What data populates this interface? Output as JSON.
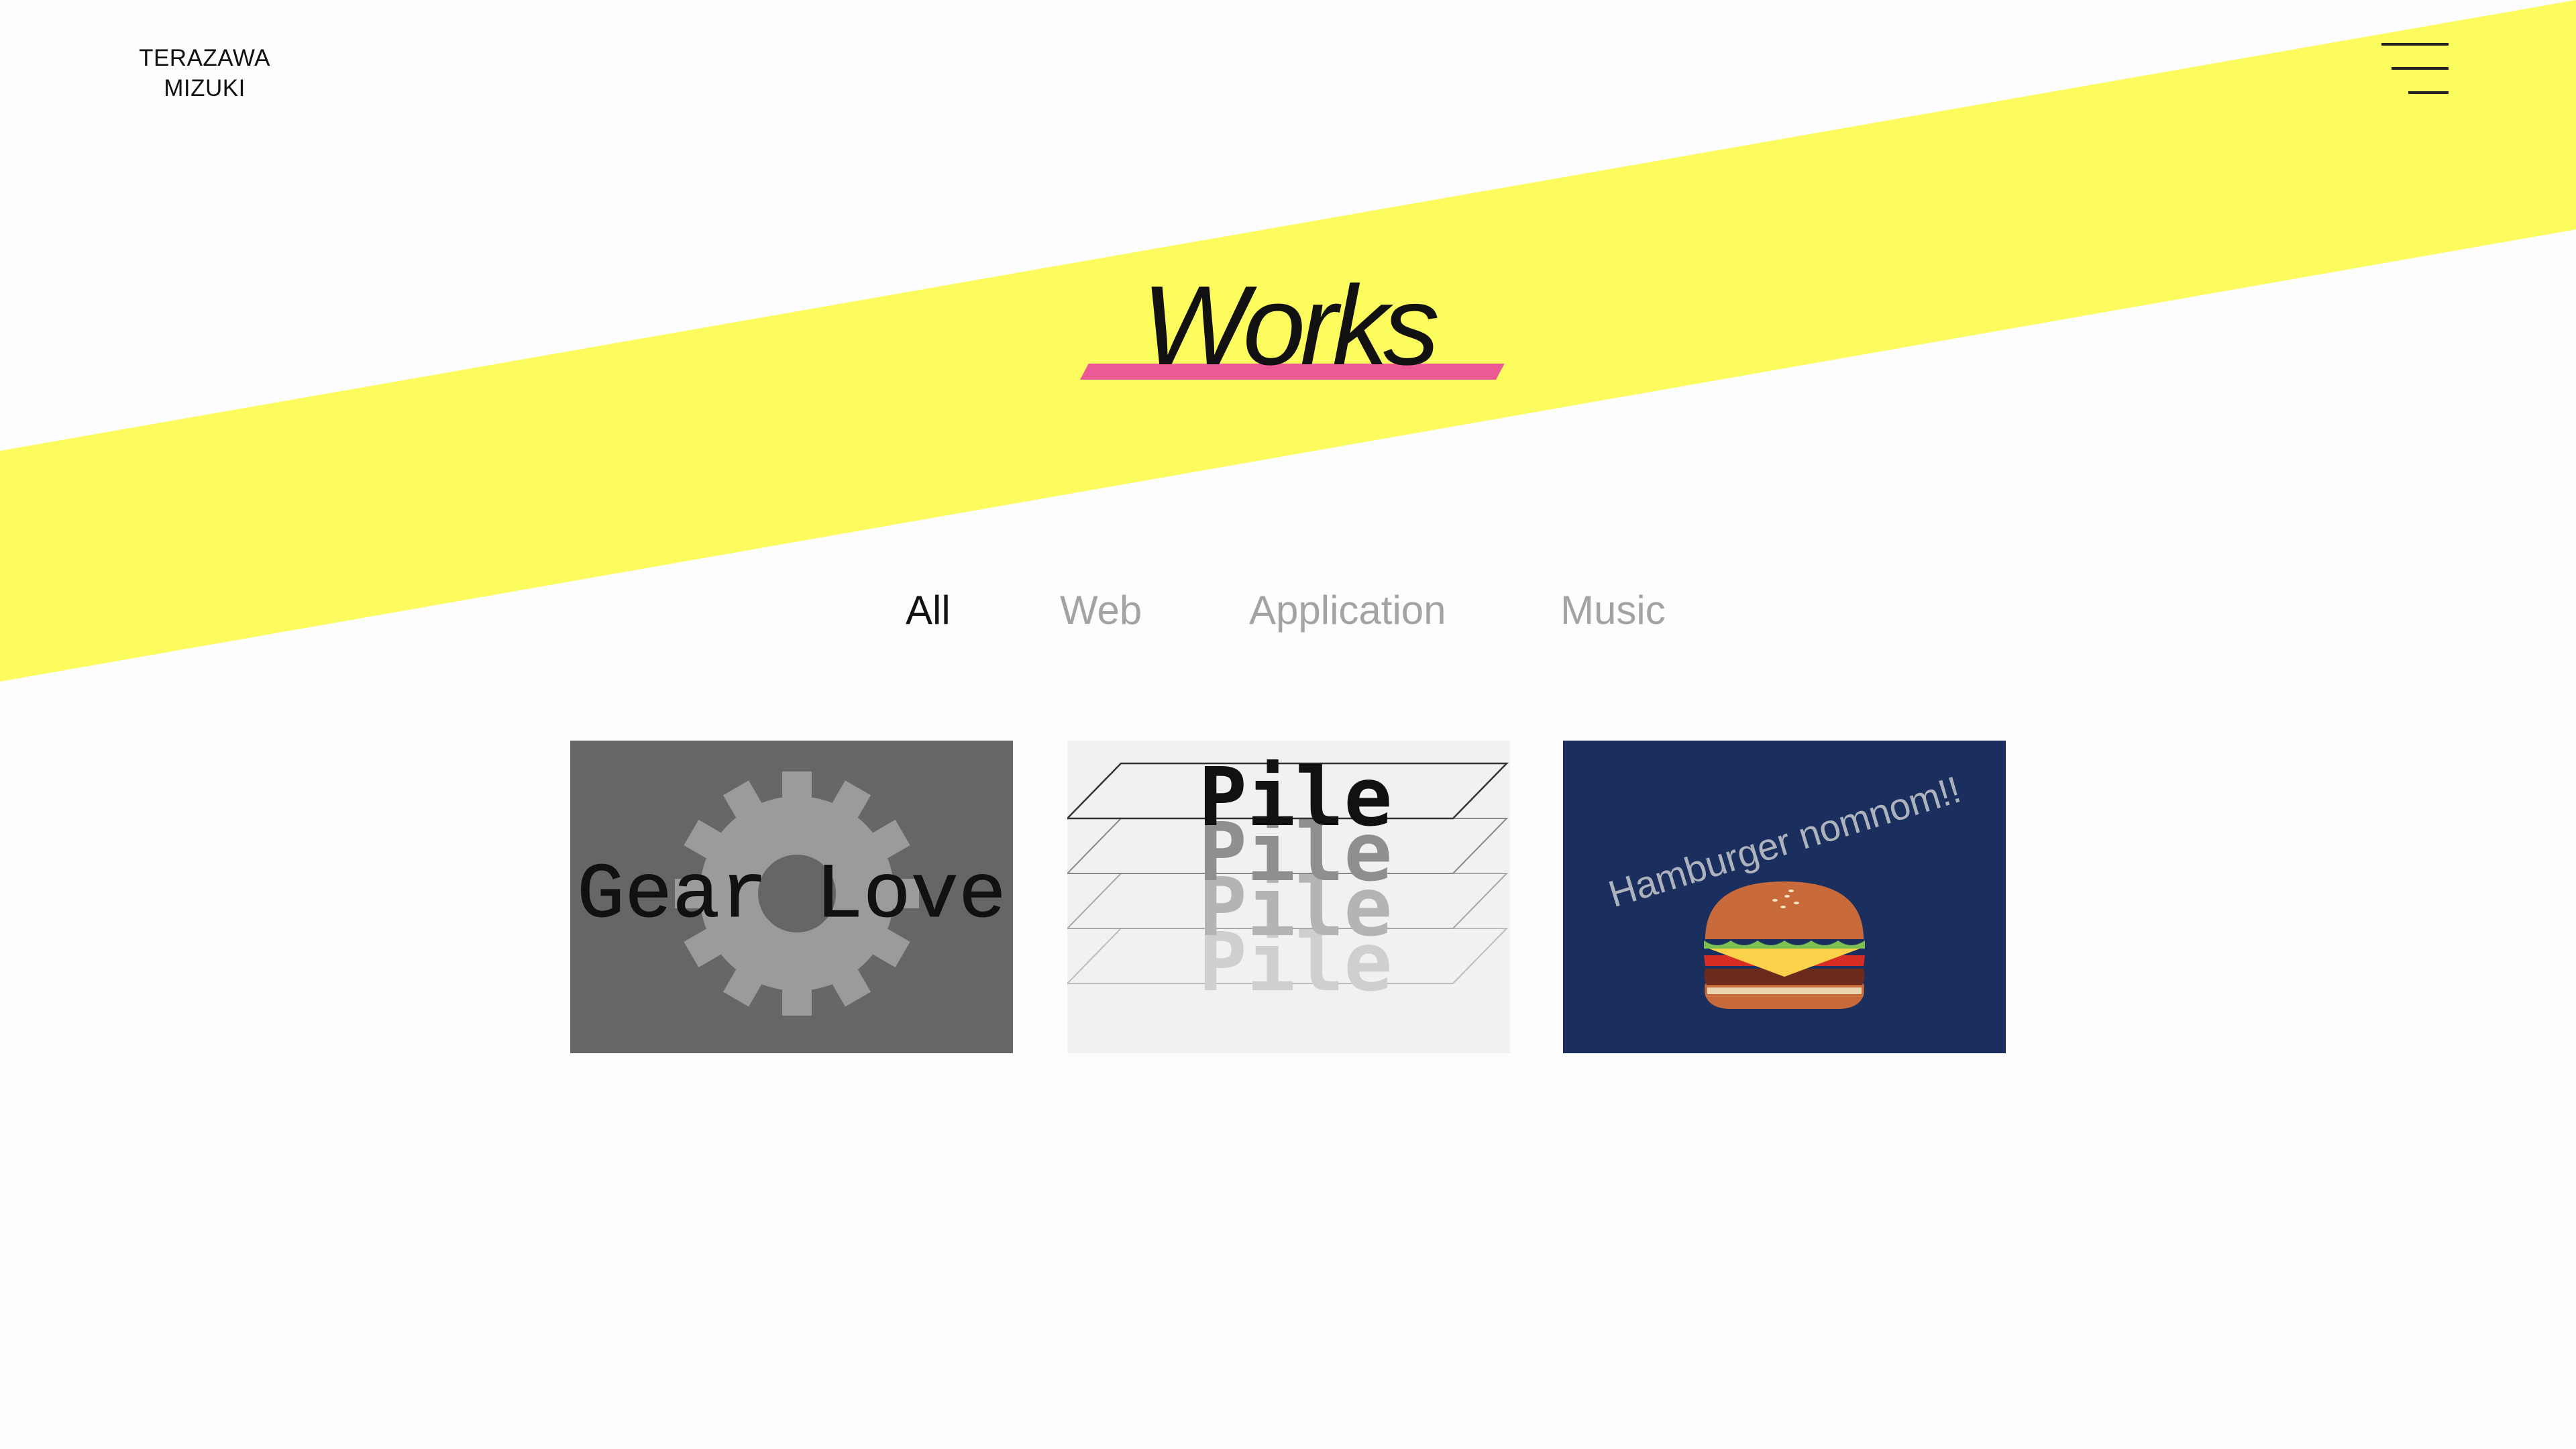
{
  "header": {
    "logo_line1": "TERAZAWA",
    "logo_line2": "MIZUKI",
    "menu_icon": "hamburger-menu-icon"
  },
  "main": {
    "title": "Works",
    "filters": [
      {
        "label": "All",
        "active": true
      },
      {
        "label": "Web",
        "active": false
      },
      {
        "label": "Application",
        "active": false
      },
      {
        "label": "Music",
        "active": false
      }
    ],
    "works": [
      {
        "title": "Gear Love",
        "icon": "gear-icon"
      },
      {
        "title": "Pile",
        "icon": "stacked-layers-icon"
      },
      {
        "title": "Hamburger nomnom!!",
        "icon": "hamburger-food-icon"
      }
    ]
  },
  "colors": {
    "background": "#fdfdfd",
    "accent_stripe": "#fdfc5e",
    "title_underline": "#ec5a95",
    "active_tab": "#111111",
    "inactive_tab": "#a3a3a3",
    "card_gear_bg": "#666666",
    "card_pile_bg": "#f0f0f0",
    "card_hamburger_bg": "#1b2f5e"
  }
}
